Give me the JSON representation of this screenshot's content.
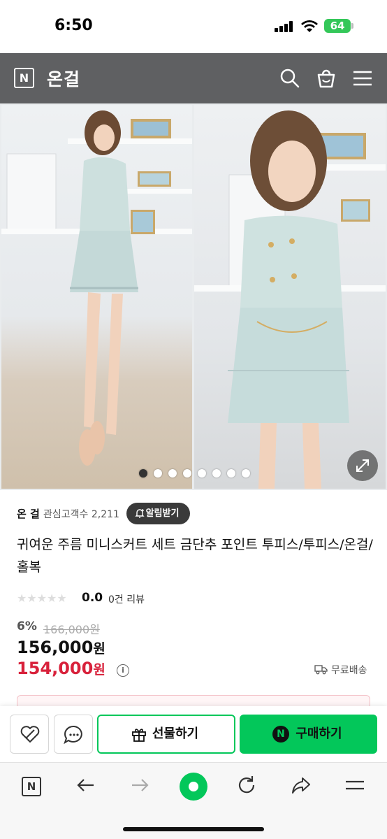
{
  "status_bar": {
    "time": "6:50",
    "battery": "64"
  },
  "top_nav": {
    "logo": "N",
    "store_name": "온걸"
  },
  "gallery": {
    "dots_total": 8,
    "active_index": 0
  },
  "info": {
    "store": "온 걸",
    "fans_label": "관심고객수 2,211",
    "alarm_label": "알림받기"
  },
  "product": {
    "title": "귀여운 주름 미니스커트 세트 금단추 포인트 투피스/투피스/온걸/홀복",
    "stars": "★★★★★",
    "rating": "0.0",
    "reviews": "0건 리뷰",
    "discount_pct": "6%",
    "original_price": "166,000원",
    "price": "156,000",
    "price_unit": "원",
    "sale_price": "154,000",
    "sale_unit": "원",
    "info_glyph": "i",
    "shipping": "무료배송"
  },
  "actions": {
    "gift_label": "선물하기",
    "buy_label": "구매하기",
    "buy_badge": "N"
  },
  "browser": {
    "logo": "N"
  },
  "colors": {
    "naver_green": "#03c75a",
    "sale_red": "#d8213b",
    "nav_gray": "#5f6062"
  }
}
